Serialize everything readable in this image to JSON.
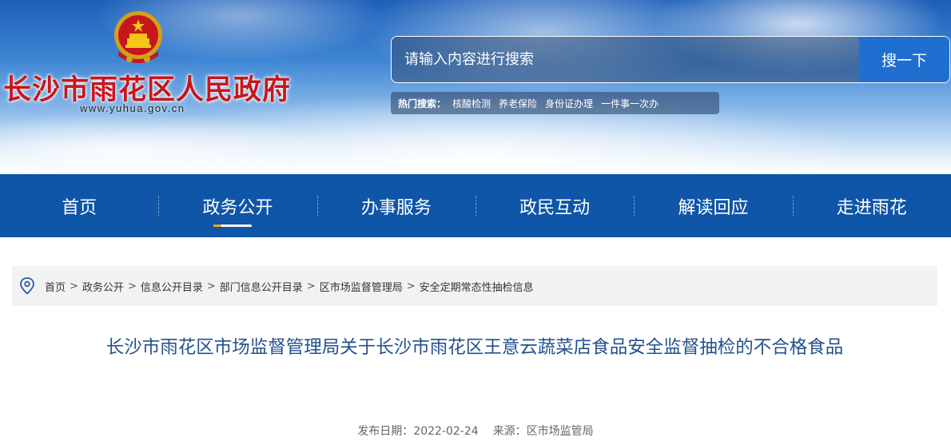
{
  "site": {
    "title": "长沙市雨花区人民政府",
    "url": "www.yuhua.gov.cn"
  },
  "search": {
    "placeholder": "请输入内容进行搜索",
    "button_label": "搜一下",
    "hot_label": "热门搜索：",
    "hot_terms": [
      "核酸检测",
      "养老保险",
      "身份证办理",
      "一件事一次办"
    ]
  },
  "nav": {
    "items": [
      "首页",
      "政务公开",
      "办事服务",
      "政民互动",
      "解读回应",
      "走进雨花"
    ],
    "active": "政务公开"
  },
  "breadcrumb": {
    "items": [
      "首页",
      "政务公开",
      "信息公开目录",
      "部门信息公开目录",
      "区市场监督管理局",
      "安全定期常态性抽检信息"
    ],
    "separator": ">"
  },
  "article": {
    "title": "长沙市雨花区市场监督管理局关于长沙市雨花区王意云蔬菜店食品安全监督抽检的不合格食品",
    "date_label": "发布日期：",
    "date": "2022-02-24",
    "source_label": "来源：",
    "source": "区市场监管局"
  },
  "colors": {
    "nav_bg": "#0f55a8",
    "title_red": "#c8161d",
    "article_title": "#23508d",
    "search_button": "#1f6fd0"
  },
  "icons": {
    "emblem": "national-emblem-icon",
    "breadcrumb": "location-pin-icon"
  }
}
